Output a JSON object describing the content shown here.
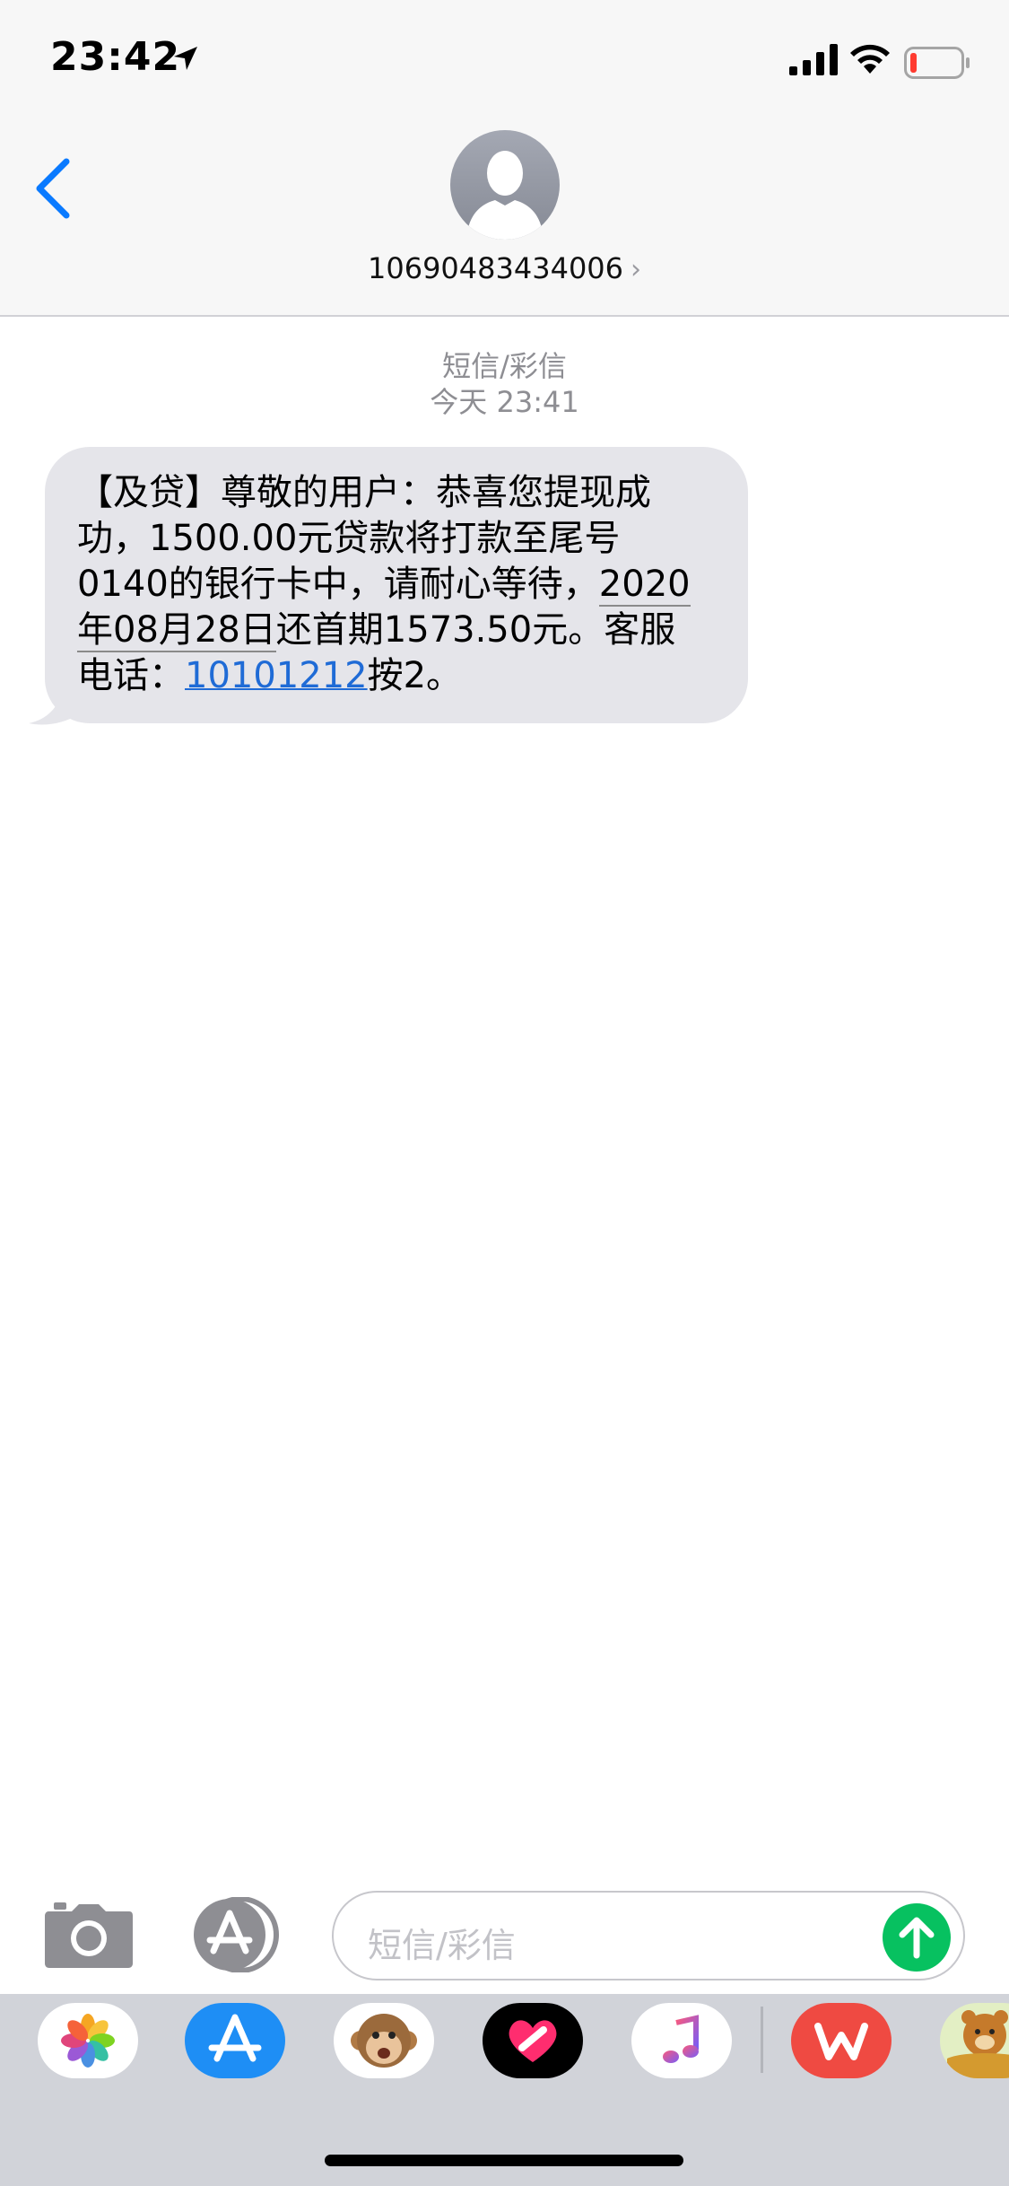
{
  "status_bar": {
    "time": "23:42"
  },
  "header": {
    "contact_number": "10690483434006",
    "contact_chevron": "›"
  },
  "thread": {
    "service_label": "短信/彩信",
    "timestamp": "今天 23:41"
  },
  "message": {
    "line1": "【及贷】尊敬的用户：恭喜您提现成",
    "line2": "功，1500.00元贷款将打款至尾号",
    "line3_a": "0140的银行卡中，请耐心等待，",
    "line3_date": "2020",
    "line4_date": "年08月28日",
    "line4_b": "还首期1573.50元。客服",
    "line5_a": "电话：",
    "line5_phone": "10101212",
    "line5_b": "按2。"
  },
  "input": {
    "placeholder": "短信/彩信"
  },
  "app_drawer": {
    "apps": [
      "photos-icon",
      "app-store-icon",
      "animoji-icon",
      "digital-touch-icon",
      "music-icon",
      "wps-icon",
      "bear-sticker-icon"
    ]
  },
  "colors": {
    "accent": "#0a7aff",
    "bubble": "#e5e5ea",
    "send": "#07c160",
    "link": "#1f6bd6"
  }
}
